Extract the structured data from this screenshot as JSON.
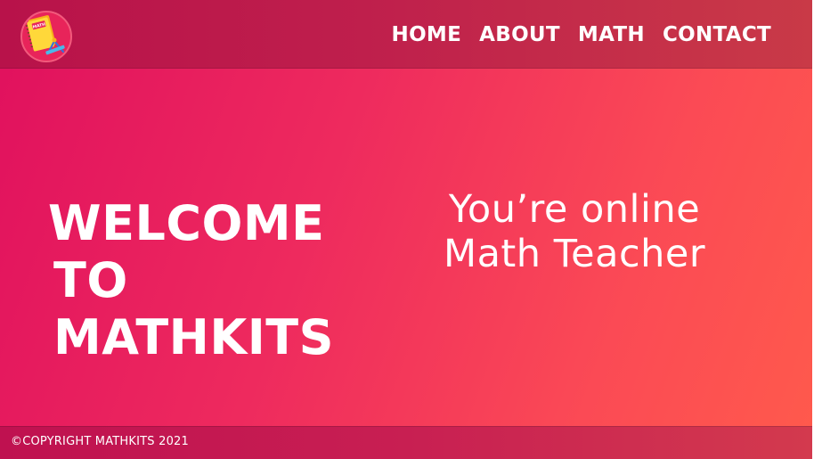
{
  "header": {
    "logo": {
      "icon": "math-book-logo-icon",
      "badge_text": "MATH"
    },
    "nav": [
      {
        "label": "HOME"
      },
      {
        "label": "ABOUT"
      },
      {
        "label": "MATH"
      },
      {
        "label": "CONTACT"
      }
    ]
  },
  "hero": {
    "welcome_lines": [
      "WELCOME",
      "TO",
      "MATHKITS"
    ],
    "tagline_lines": [
      "You’re online",
      "Math Teacher"
    ]
  },
  "footer": {
    "copyright": "©COPYRIGHT MATHKITS 2021"
  },
  "colors": {
    "hero_start": "#e0105e",
    "hero_end": "#ff5a4c",
    "header": "#bf1f4c",
    "footer": "#c81f52",
    "text": "#ffffff"
  }
}
